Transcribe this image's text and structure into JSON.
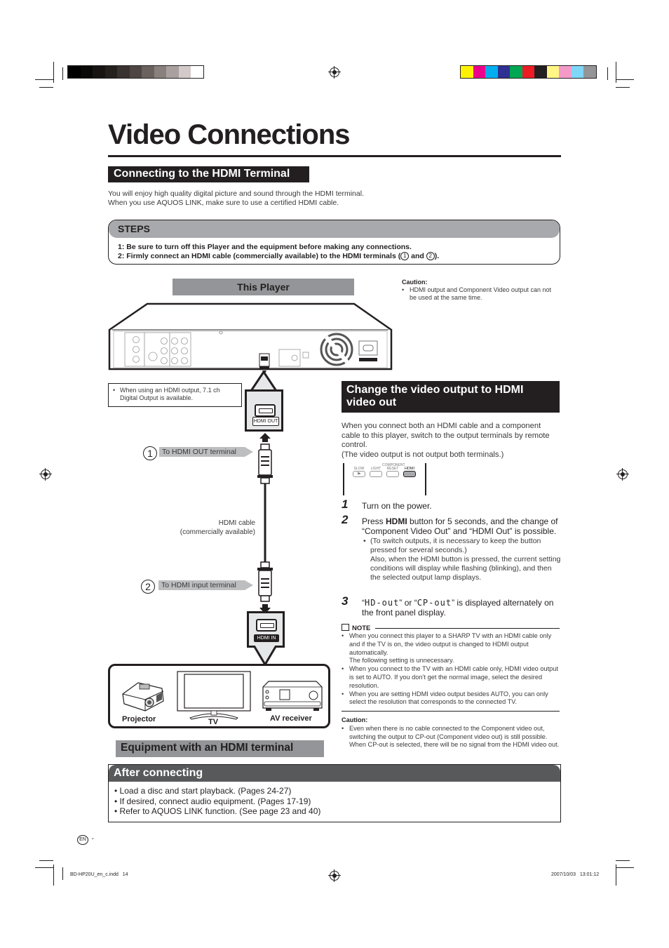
{
  "color_bars": {
    "grayscale": [
      "#000000",
      "#0b0908",
      "#171413",
      "#24201e",
      "#3a3230",
      "#4d4644",
      "#6b625f",
      "#8a817e",
      "#a9a19f",
      "#d3cbc9",
      "#ffffff"
    ],
    "process": [
      "#fff200",
      "#ec008c",
      "#00aeef",
      "#2e3192",
      "#00a651",
      "#ed1c24",
      "#231f20",
      "#fff685",
      "#f49ac9",
      "#7fd7f7",
      "#939598"
    ]
  },
  "page": {
    "title": "Video Connections"
  },
  "hdmi_section": {
    "heading": "Connecting to the HDMI Terminal",
    "intro_lines": [
      "You will enjoy high quality digital picture and sound through the HDMI terminal.",
      "When you use AQUOS LINK, make sure to use a certified HDMI cable."
    ]
  },
  "steps": {
    "heading": "STEPS",
    "line1": "1: Be sure to turn off this Player and the equipment before making any connections.",
    "line2_prefix": "2: Firmly connect an HDMI cable (commercially available) to the HDMI terminals (",
    "line2_circ1": "1",
    "line2_and": " and ",
    "line2_circ2": "2",
    "line2_suffix": ")."
  },
  "diagram": {
    "this_player_label": "This Player",
    "caution_title": "Caution:",
    "caution_text": "HDMI output and Component Video output can not be used at the same time.",
    "output_note": "When using an HDMI output, 7.1 ch Digital Output is available.",
    "hdmi_out_tag": "HDMI OUT",
    "hdmi_in_tag": "HDMI IN",
    "callout1_num": "1",
    "callout1_text": "To HDMI OUT terminal",
    "callout2_num": "2",
    "callout2_text": "To HDMI input terminal",
    "cable_line1": "HDMI cable",
    "cable_line2": "(commercially available)",
    "equipment": [
      "Projector",
      "TV",
      "AV receiver"
    ],
    "equipment_heading": "Equipment with an HDMI terminal"
  },
  "video_out": {
    "heading": "Change the video output to HDMI video out",
    "intro": "When you connect both an HDMI cable and a component cable to this player, switch to the output terminals by remote control.",
    "intro_note": "(The video output is not output both terminals.)",
    "remote_buttons": [
      {
        "label": "SLOW",
        "glyph": "I▶"
      },
      {
        "label": "LIGHT",
        "glyph": ""
      },
      {
        "label": "RESET",
        "glyph": "",
        "overlabel": "COMPONENT"
      },
      {
        "label": "HDMI",
        "glyph": ""
      }
    ],
    "steps": [
      {
        "num": "1",
        "text": "Turn on the power."
      },
      {
        "num": "2",
        "text_before": "Press ",
        "bold": "HDMI",
        "text_after": " button for 5 seconds, and the change of “Component Video Out” and “HDMI Out” is possible.",
        "sub_bullet": "(To switch outputs, it is necessary to keep the button pressed for several seconds.)",
        "sub_extra": "Also, when the HDMI button is pressed, the current setting conditions will display while flashing (blinking), and then the selected output lamp displays."
      },
      {
        "num": "3",
        "quote1": "HD-out",
        "or": "” or “",
        "quote2": "CP-out",
        "text_after": "” is displayed alternately on the front panel display."
      }
    ],
    "note_title": "NOTE",
    "notes": [
      "When you connect this player to a SHARP TV with an HDMI cable only and if the TV is on, the video output is changed to HDMI output automatically.",
      "When you connect to the TV with an HDMI cable only, HDMI video output is set to AUTO. If you don’t get the normal image, select the desired resolution.",
      "When you are setting HDMI video output besides AUTO, you can only select the resolution that corresponds to the connected TV."
    ],
    "note1_extra": "The following setting is unnecessary.",
    "caution_title": "Caution:",
    "caution_text": "Even when there is no cable connected to the Component video out, switching the output to CP-out (Component video out) is still possible. When CP-out is selected, there will be no signal from the HDMI video out."
  },
  "after_connecting": {
    "heading": "After connecting",
    "items": [
      "Load a disc and start playback. (Pages 24-27)",
      "If desired, connect audio equipment. (Pages 17-19)",
      "Refer to AQUOS LINK function. (See page 23 and 40)"
    ]
  },
  "footer": {
    "lang_badge": "EN",
    "page_dash": "-",
    "file_name": "BD-HP20U_en_c.indd   14",
    "timestamp": "2007/10/03   13:01:12"
  }
}
